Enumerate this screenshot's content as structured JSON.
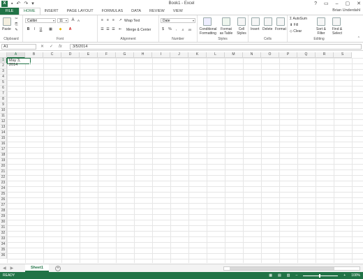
{
  "window": {
    "title": "Book1 - Excel",
    "user": "Brian Underdahl",
    "controls": [
      "?",
      "▭",
      "–",
      "▢",
      "✕"
    ]
  },
  "qat": [
    "↶",
    "↷",
    "▾"
  ],
  "tabs": [
    "FILE",
    "HOME",
    "INSERT",
    "PAGE LAYOUT",
    "FORMULAS",
    "DATA",
    "REVIEW",
    "VIEW"
  ],
  "ribbon": {
    "clipboard": {
      "paste": "Paste",
      "label": "Clipboard"
    },
    "font": {
      "name": "Calibri",
      "size": "11",
      "label": "Font",
      "bold": "B",
      "italic": "I",
      "underline": "U",
      "grow": "A",
      "shrink": "A"
    },
    "alignment": {
      "wrap": "Wrap Text",
      "merge": "Merge & Center",
      "label": "Alignment"
    },
    "number": {
      "format": "Date",
      "currency": "$",
      "percent": "%",
      "comma": ",",
      "inc": ".0",
      "dec": ".00",
      "label": "Number"
    },
    "styles": {
      "conditional": "Conditional Formatting",
      "format_table": "Format as Table",
      "cell_styles": "Cell Styles",
      "label": "Styles"
    },
    "cells": {
      "insert": "Insert",
      "delete": "Delete",
      "format": "Format",
      "label": "Cells"
    },
    "editing": {
      "autosum": "AutoSum",
      "fill": "Fill",
      "clear": "Clear",
      "sort": "Sort & Filter",
      "find": "Find & Select",
      "label": "Editing"
    }
  },
  "formula_bar": {
    "name_box": "A1",
    "cancel": "✕",
    "enter": "✓",
    "fx": "fx",
    "value": "3/5/2014"
  },
  "grid": {
    "columns": [
      "A",
      "B",
      "C",
      "D",
      "E",
      "F",
      "G",
      "H",
      "I",
      "J",
      "K",
      "L",
      "M",
      "N",
      "O",
      "P",
      "Q",
      "R",
      "S"
    ],
    "rows": [
      "1",
      "2",
      "3",
      "4",
      "5",
      "6",
      "7",
      "8",
      "9",
      "10",
      "11",
      "12",
      "13",
      "14",
      "15",
      "16",
      "17",
      "18",
      "19",
      "20",
      "21",
      "22",
      "23",
      "24",
      "25",
      "26",
      "27",
      "28",
      "29",
      "30",
      "31",
      "32",
      "33",
      "34",
      "35",
      "36"
    ],
    "active_cell_value": "May 3, 2014"
  },
  "sheets": {
    "nav_prev": "◀",
    "nav_next": "▶",
    "active": "Sheet1",
    "add": "+"
  },
  "status": {
    "ready": "READY",
    "zoom": "100%",
    "zoom_minus": "–",
    "zoom_plus": "+"
  }
}
